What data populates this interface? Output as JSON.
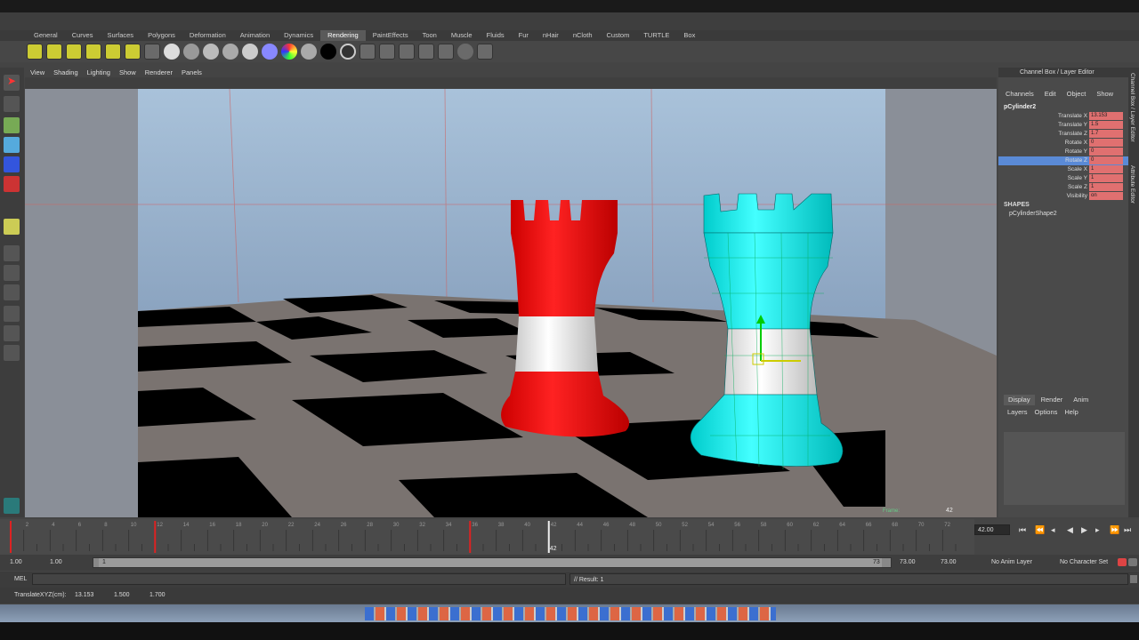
{
  "shelf_tabs": [
    "General",
    "Curves",
    "Surfaces",
    "Polygons",
    "Deformation",
    "Animation",
    "Dynamics",
    "Rendering",
    "PaintEffects",
    "Toon",
    "Muscle",
    "Fluids",
    "Fur",
    "nHair",
    "nCloth",
    "Custom",
    "TURTLE",
    "Box"
  ],
  "active_shelf_tab": "Rendering",
  "panel_menu": [
    "View",
    "Shading",
    "Lighting",
    "Show",
    "Renderer",
    "Panels"
  ],
  "channel_box": {
    "title": "Channel Box / Layer Editor",
    "menu": [
      "Channels",
      "Edit",
      "Object",
      "Show"
    ],
    "object": "pCylinder2",
    "attributes": [
      {
        "label": "Translate X",
        "value": "13.153"
      },
      {
        "label": "Translate Y",
        "value": "1.5"
      },
      {
        "label": "Translate Z",
        "value": "1.7"
      },
      {
        "label": "Rotate X",
        "value": "0"
      },
      {
        "label": "Rotate Y",
        "value": "0"
      },
      {
        "label": "Rotate Z",
        "value": "0"
      },
      {
        "label": "Scale X",
        "value": "1"
      },
      {
        "label": "Scale Y",
        "value": "1"
      },
      {
        "label": "Scale Z",
        "value": "1"
      },
      {
        "label": "Visibility",
        "value": "on"
      }
    ],
    "shapes_label": "SHAPES",
    "shape_name": "pCylinderShape2"
  },
  "side_tabs": [
    "Channel Box / Layer Editor",
    "Attribute Editor"
  ],
  "layer_tabs": [
    "Display",
    "Render",
    "Anim"
  ],
  "layer_menu": [
    "Layers",
    "Options",
    "Help"
  ],
  "viewport": {
    "frame_label": "Frame:",
    "frame_value": "42"
  },
  "timeline": {
    "ticks": [
      "2",
      "4",
      "6",
      "8",
      "10",
      "12",
      "14",
      "16",
      "18",
      "20",
      "22",
      "24",
      "26",
      "28",
      "30",
      "32",
      "34",
      "36",
      "38",
      "40",
      "42",
      "44",
      "46",
      "48",
      "50",
      "52",
      "54",
      "56",
      "58",
      "60",
      "62",
      "64",
      "66",
      "68",
      "70",
      "72"
    ],
    "current_frame_label": "42",
    "current_frame_field": "42.00"
  },
  "range": {
    "start": "1.00",
    "start2": "1.00",
    "slider_start": "1",
    "slider_end": "73",
    "end": "73.00",
    "end2": "73.00",
    "anim_layer": "No Anim Layer",
    "char_set": "No Character Set"
  },
  "command": {
    "lang": "MEL",
    "result": "// Result: 1"
  },
  "help": {
    "label": "TranslateXYZ(cm):",
    "x": "13.153",
    "y": "1.500",
    "z": "1.700"
  },
  "colors": {
    "red_rook": "#e01010",
    "cyan_rook": "#10e0e8",
    "selected_row": "#5a8ad6",
    "keyed_field": "#e07070"
  }
}
